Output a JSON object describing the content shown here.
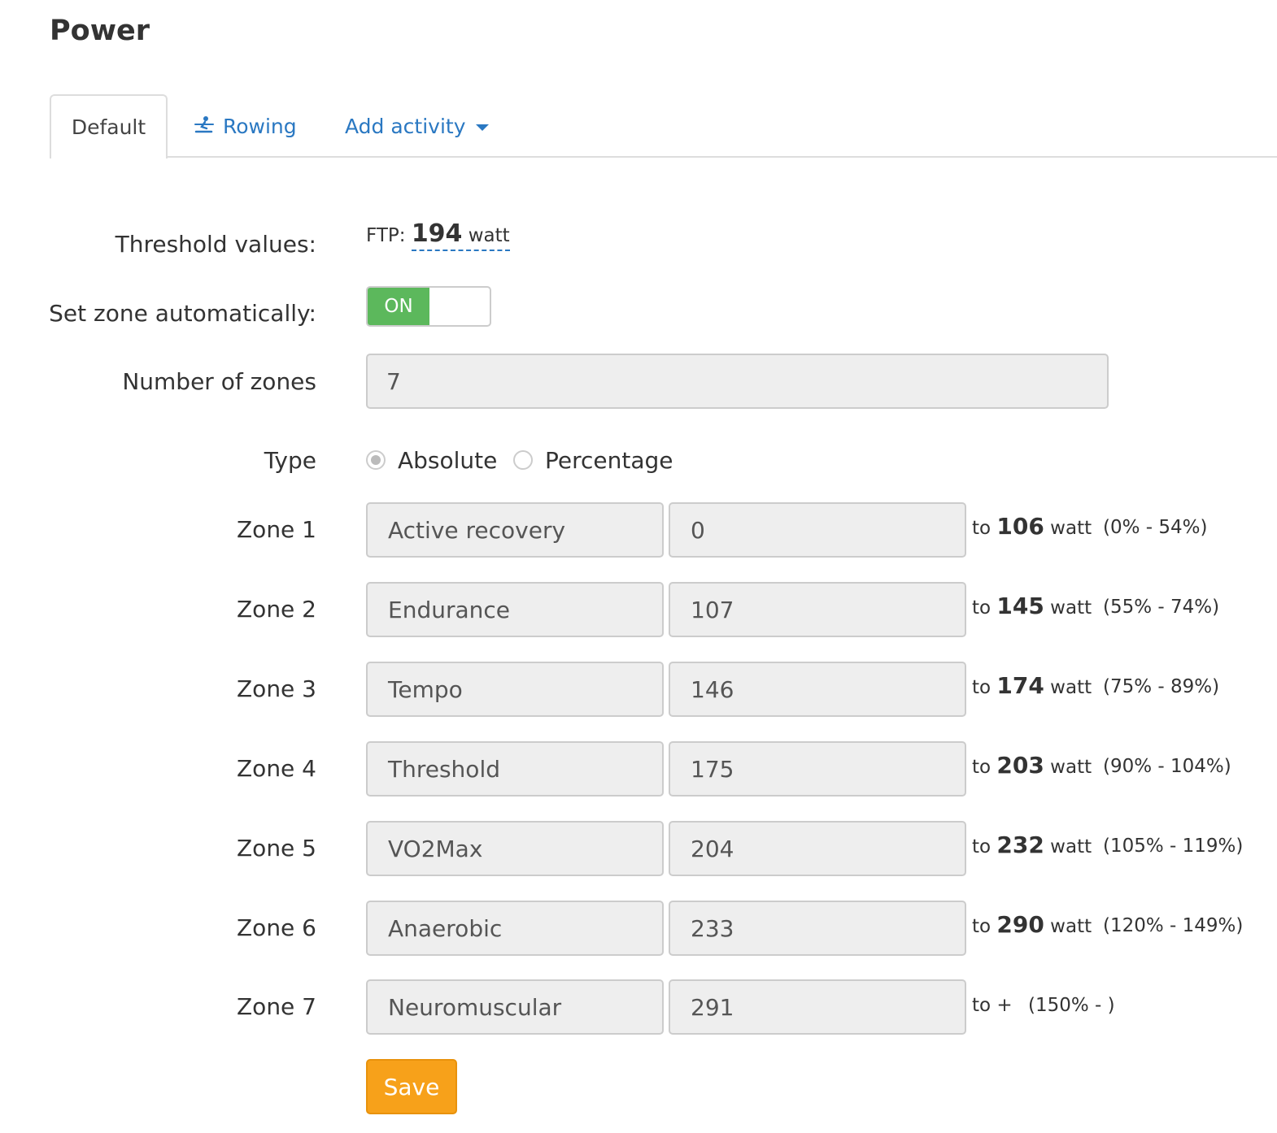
{
  "page": {
    "title": "Power"
  },
  "tabs": [
    {
      "label": "Default",
      "active": true
    },
    {
      "label": "Rowing",
      "icon": "rowing-icon"
    },
    {
      "label": "Add activity",
      "icon": "caret-down-icon"
    }
  ],
  "threshold": {
    "label": "Threshold values:",
    "prefix": "FTP:",
    "value": "194",
    "unit": "watt"
  },
  "auto_zone": {
    "label": "Set zone automatically:",
    "state": "ON"
  },
  "zone_count": {
    "label": "Number of zones",
    "value": "7"
  },
  "type": {
    "label": "Type",
    "options": [
      {
        "label": "Absolute",
        "checked": true
      },
      {
        "label": "Percentage",
        "checked": false
      }
    ]
  },
  "zones": [
    {
      "label": "Zone 1",
      "name": "Active recovery",
      "from": "0",
      "to_prefix": "to",
      "to": "106",
      "unit": "watt",
      "pct": "(0% - 54%)"
    },
    {
      "label": "Zone 2",
      "name": "Endurance",
      "from": "107",
      "to_prefix": "to",
      "to": "145",
      "unit": "watt",
      "pct": "(55% - 74%)"
    },
    {
      "label": "Zone 3",
      "name": "Tempo",
      "from": "146",
      "to_prefix": "to",
      "to": "174",
      "unit": "watt",
      "pct": "(75% - 89%)"
    },
    {
      "label": "Zone 4",
      "name": "Threshold",
      "from": "175",
      "to_prefix": "to",
      "to": "203",
      "unit": "watt",
      "pct": "(90% - 104%)"
    },
    {
      "label": "Zone 5",
      "name": "VO2Max",
      "from": "204",
      "to_prefix": "to",
      "to": "232",
      "unit": "watt",
      "pct": "(105% - 119%)"
    },
    {
      "label": "Zone 6",
      "name": "Anaerobic",
      "from": "233",
      "to_prefix": "to",
      "to": "290",
      "unit": "watt",
      "pct": "(120% - 149%)"
    },
    {
      "label": "Zone 7",
      "name": "Neuromuscular",
      "from": "291",
      "to_prefix": "to +",
      "to": "",
      "unit": "",
      "pct": "(150% - )"
    }
  ],
  "actions": {
    "save_label": "Save"
  },
  "colors": {
    "link": "#2a78c2",
    "toggle_on": "#5cb85c",
    "save": "#f7a11a"
  }
}
